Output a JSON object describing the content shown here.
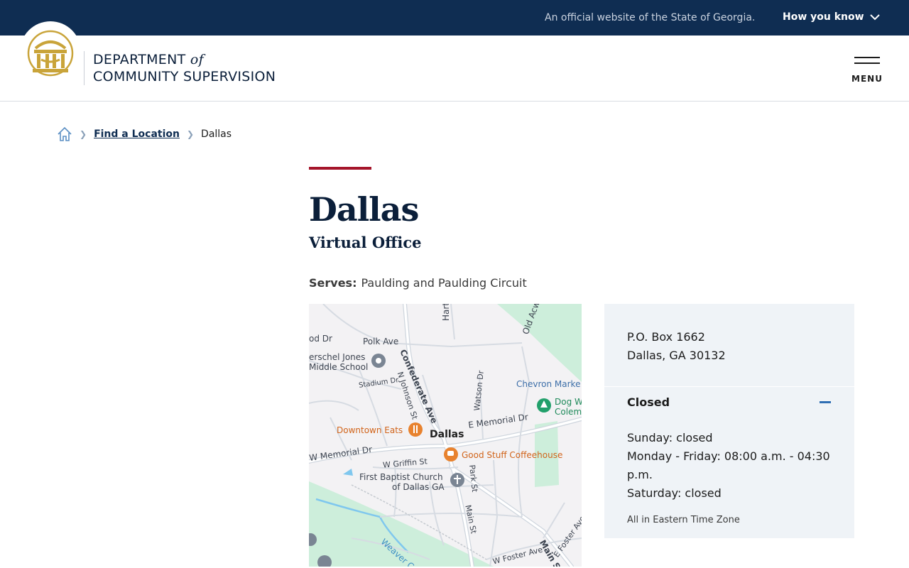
{
  "banner": {
    "official_text": "An official website of the State of Georgia.",
    "how_you_know": "How you know"
  },
  "header": {
    "agency_line1": "DEPARTMENT",
    "agency_of": "of",
    "agency_line2": "COMMUNITY SUPERVISION",
    "menu_label": "MENU"
  },
  "breadcrumb": {
    "items": [
      {
        "label": "Find a Location"
      },
      {
        "label": "Dallas"
      }
    ]
  },
  "location": {
    "title": "Dallas",
    "subtitle": "Virtual Office",
    "serves_label": "Serves:",
    "serves_value": "Paulding and Paulding Circuit",
    "address_line1": "P.O. Box 1662",
    "address_line2": "Dallas, GA 30132",
    "status": "Closed",
    "hours": [
      "Sunday: closed",
      "Monday - Friday: 08:00 a.m. - 04:30 p.m.",
      "Saturday: closed"
    ],
    "timezone_note": "All in Eastern Time Zone"
  },
  "map": {
    "labels": {
      "polk_ave": "Polk Ave",
      "hart": "Hart",
      "old_acworth": "Old Acwo",
      "herschel_1": "erschel Jones",
      "herschel_2": "Middle School",
      "stadium_dr": "Stadium Dr",
      "confederate": "Confederate Ave",
      "n_johnson": "N Johnson St",
      "watson_dr": "Watson Dr",
      "chevron": "Chevron Marke",
      "dog_1": "Dog W",
      "dog_2": "Colem",
      "e_memorial": "E Memorial Dr",
      "downtown_eats": "Downtown Eats",
      "dallas": "Dallas",
      "w_memorial": "W Memorial Dr",
      "good_stuff": "Good Stuff Coffeehouse",
      "w_griffin": "W Griffin St",
      "park_st": "Park St",
      "fbc_1": "First Baptist Church",
      "fbc_2": "of Dallas GA",
      "main_st": "Main St",
      "main_st2": "Main St",
      "weaver": "Weaver C",
      "w_foster": "W Foster Ave",
      "e_foster": "E Foster Ave",
      "od_dr": "od Dr"
    }
  },
  "colors": {
    "banner_bg": "#0f2d52",
    "accent_red": "#a5152b",
    "card_bg": "#eff3f7",
    "collapse_blue": "#2f6eb3",
    "seal_gold": "#c9a43a"
  },
  "icons": {
    "breadcrumb_home": "home-icon",
    "how_you_know": "chevron-down-icon",
    "menu": "hamburger-icon",
    "collapse": "minus-icon"
  }
}
